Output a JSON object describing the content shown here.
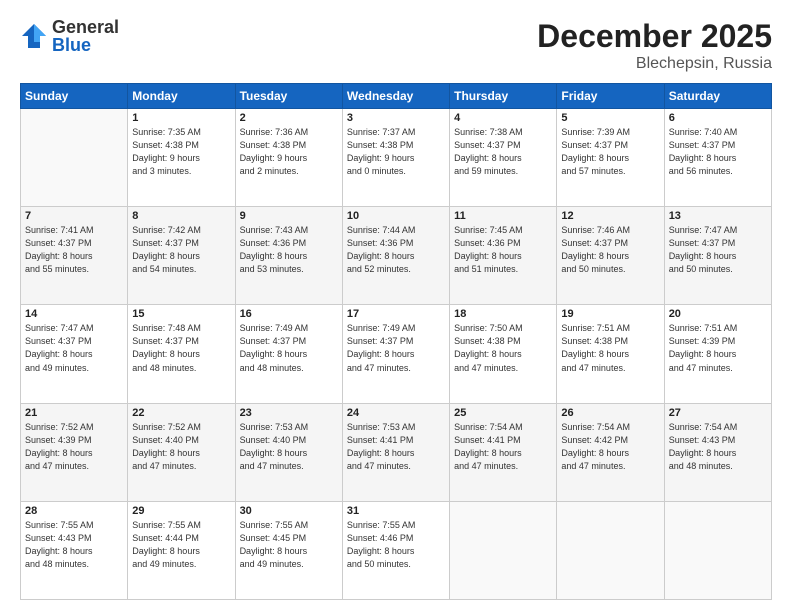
{
  "header": {
    "logo_general": "General",
    "logo_blue": "Blue",
    "title": "December 2025",
    "location": "Blechepsin, Russia"
  },
  "days_of_week": [
    "Sunday",
    "Monday",
    "Tuesday",
    "Wednesday",
    "Thursday",
    "Friday",
    "Saturday"
  ],
  "weeks": [
    [
      {
        "day": "",
        "info": ""
      },
      {
        "day": "1",
        "info": "Sunrise: 7:35 AM\nSunset: 4:38 PM\nDaylight: 9 hours\nand 3 minutes."
      },
      {
        "day": "2",
        "info": "Sunrise: 7:36 AM\nSunset: 4:38 PM\nDaylight: 9 hours\nand 2 minutes."
      },
      {
        "day": "3",
        "info": "Sunrise: 7:37 AM\nSunset: 4:38 PM\nDaylight: 9 hours\nand 0 minutes."
      },
      {
        "day": "4",
        "info": "Sunrise: 7:38 AM\nSunset: 4:37 PM\nDaylight: 8 hours\nand 59 minutes."
      },
      {
        "day": "5",
        "info": "Sunrise: 7:39 AM\nSunset: 4:37 PM\nDaylight: 8 hours\nand 57 minutes."
      },
      {
        "day": "6",
        "info": "Sunrise: 7:40 AM\nSunset: 4:37 PM\nDaylight: 8 hours\nand 56 minutes."
      }
    ],
    [
      {
        "day": "7",
        "info": "Sunrise: 7:41 AM\nSunset: 4:37 PM\nDaylight: 8 hours\nand 55 minutes."
      },
      {
        "day": "8",
        "info": "Sunrise: 7:42 AM\nSunset: 4:37 PM\nDaylight: 8 hours\nand 54 minutes."
      },
      {
        "day": "9",
        "info": "Sunrise: 7:43 AM\nSunset: 4:36 PM\nDaylight: 8 hours\nand 53 minutes."
      },
      {
        "day": "10",
        "info": "Sunrise: 7:44 AM\nSunset: 4:36 PM\nDaylight: 8 hours\nand 52 minutes."
      },
      {
        "day": "11",
        "info": "Sunrise: 7:45 AM\nSunset: 4:36 PM\nDaylight: 8 hours\nand 51 minutes."
      },
      {
        "day": "12",
        "info": "Sunrise: 7:46 AM\nSunset: 4:37 PM\nDaylight: 8 hours\nand 50 minutes."
      },
      {
        "day": "13",
        "info": "Sunrise: 7:47 AM\nSunset: 4:37 PM\nDaylight: 8 hours\nand 50 minutes."
      }
    ],
    [
      {
        "day": "14",
        "info": "Sunrise: 7:47 AM\nSunset: 4:37 PM\nDaylight: 8 hours\nand 49 minutes."
      },
      {
        "day": "15",
        "info": "Sunrise: 7:48 AM\nSunset: 4:37 PM\nDaylight: 8 hours\nand 48 minutes."
      },
      {
        "day": "16",
        "info": "Sunrise: 7:49 AM\nSunset: 4:37 PM\nDaylight: 8 hours\nand 48 minutes."
      },
      {
        "day": "17",
        "info": "Sunrise: 7:49 AM\nSunset: 4:37 PM\nDaylight: 8 hours\nand 47 minutes."
      },
      {
        "day": "18",
        "info": "Sunrise: 7:50 AM\nSunset: 4:38 PM\nDaylight: 8 hours\nand 47 minutes."
      },
      {
        "day": "19",
        "info": "Sunrise: 7:51 AM\nSunset: 4:38 PM\nDaylight: 8 hours\nand 47 minutes."
      },
      {
        "day": "20",
        "info": "Sunrise: 7:51 AM\nSunset: 4:39 PM\nDaylight: 8 hours\nand 47 minutes."
      }
    ],
    [
      {
        "day": "21",
        "info": "Sunrise: 7:52 AM\nSunset: 4:39 PM\nDaylight: 8 hours\nand 47 minutes."
      },
      {
        "day": "22",
        "info": "Sunrise: 7:52 AM\nSunset: 4:40 PM\nDaylight: 8 hours\nand 47 minutes."
      },
      {
        "day": "23",
        "info": "Sunrise: 7:53 AM\nSunset: 4:40 PM\nDaylight: 8 hours\nand 47 minutes."
      },
      {
        "day": "24",
        "info": "Sunrise: 7:53 AM\nSunset: 4:41 PM\nDaylight: 8 hours\nand 47 minutes."
      },
      {
        "day": "25",
        "info": "Sunrise: 7:54 AM\nSunset: 4:41 PM\nDaylight: 8 hours\nand 47 minutes."
      },
      {
        "day": "26",
        "info": "Sunrise: 7:54 AM\nSunset: 4:42 PM\nDaylight: 8 hours\nand 47 minutes."
      },
      {
        "day": "27",
        "info": "Sunrise: 7:54 AM\nSunset: 4:43 PM\nDaylight: 8 hours\nand 48 minutes."
      }
    ],
    [
      {
        "day": "28",
        "info": "Sunrise: 7:55 AM\nSunset: 4:43 PM\nDaylight: 8 hours\nand 48 minutes."
      },
      {
        "day": "29",
        "info": "Sunrise: 7:55 AM\nSunset: 4:44 PM\nDaylight: 8 hours\nand 49 minutes."
      },
      {
        "day": "30",
        "info": "Sunrise: 7:55 AM\nSunset: 4:45 PM\nDaylight: 8 hours\nand 49 minutes."
      },
      {
        "day": "31",
        "info": "Sunrise: 7:55 AM\nSunset: 4:46 PM\nDaylight: 8 hours\nand 50 minutes."
      },
      {
        "day": "",
        "info": ""
      },
      {
        "day": "",
        "info": ""
      },
      {
        "day": "",
        "info": ""
      }
    ]
  ]
}
